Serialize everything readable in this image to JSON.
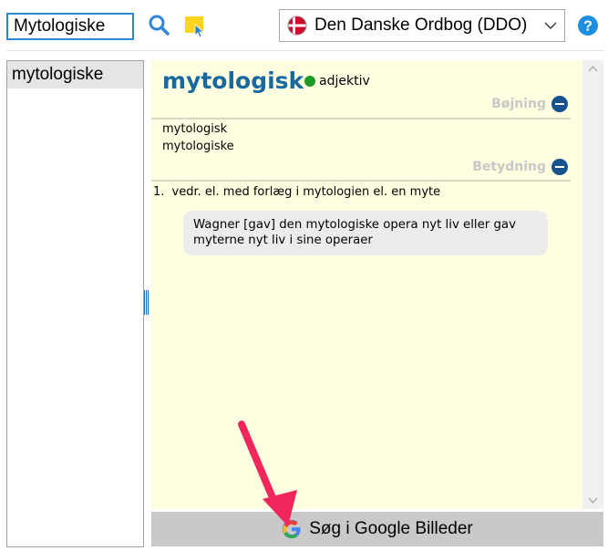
{
  "toolbar": {
    "search_value": "Mytologiske",
    "search_icon": "search-icon",
    "sticky_icon": "sticky-note-icon",
    "dictionary_label": "Den Danske Ordbog (DDO)",
    "dictionary_flag_icon": "danish-flag-icon",
    "help_label": "?"
  },
  "word_list": {
    "items": [
      "mytologiske"
    ]
  },
  "entry": {
    "headword": "mytologisk",
    "pos": "adjektiv",
    "inflection_heading": "Bøjning",
    "inflections": [
      "mytologisk",
      "mytologiske"
    ],
    "meaning_heading": "Betydning",
    "definitions": [
      {
        "number": "1.",
        "text": "vedr. el. med forlæg i mytologien el. en myte",
        "example": "Wagner [gav] den mytologiske opera nyt liv eller gav myterne nyt liv i sine operaer"
      }
    ]
  },
  "google_button": {
    "label": "Søg i Google Billeder",
    "icon": "google-g-icon"
  },
  "colors": {
    "accent": "#2f86d6",
    "headword": "#17699f",
    "pos_dot": "#1f9a23",
    "entry_background": "#fefee1",
    "annotation_arrow": "#f0265d"
  }
}
